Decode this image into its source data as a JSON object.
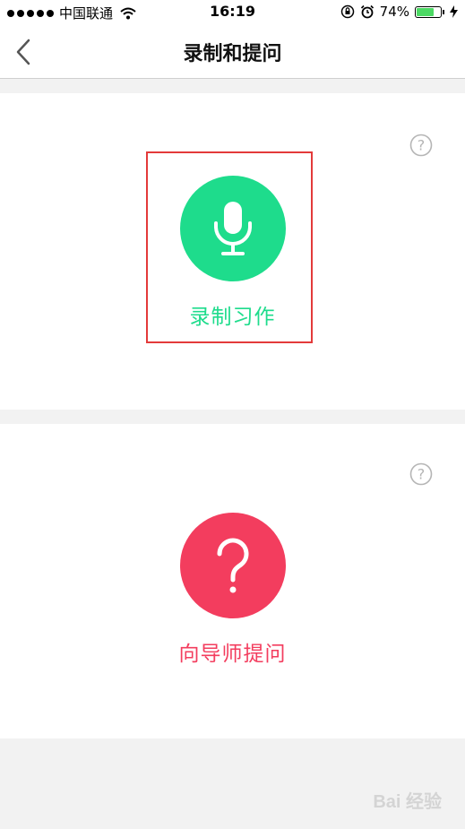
{
  "status": {
    "carrier": "中国联通",
    "time": "16:19",
    "battery": "74%",
    "battery_level": 0.74,
    "battery_color": "#4cd964"
  },
  "nav": {
    "title": "录制和提问",
    "back_icon": "chevron-left-icon"
  },
  "actions": {
    "record": {
      "label": "录制习作",
      "icon": "microphone-icon",
      "color": "#1edc8c"
    },
    "ask": {
      "label": "向导师提问",
      "icon": "question-mark-icon",
      "color": "#f33d5e"
    }
  },
  "help_icon": "help-circle-icon",
  "watermark": "Bai 经验"
}
